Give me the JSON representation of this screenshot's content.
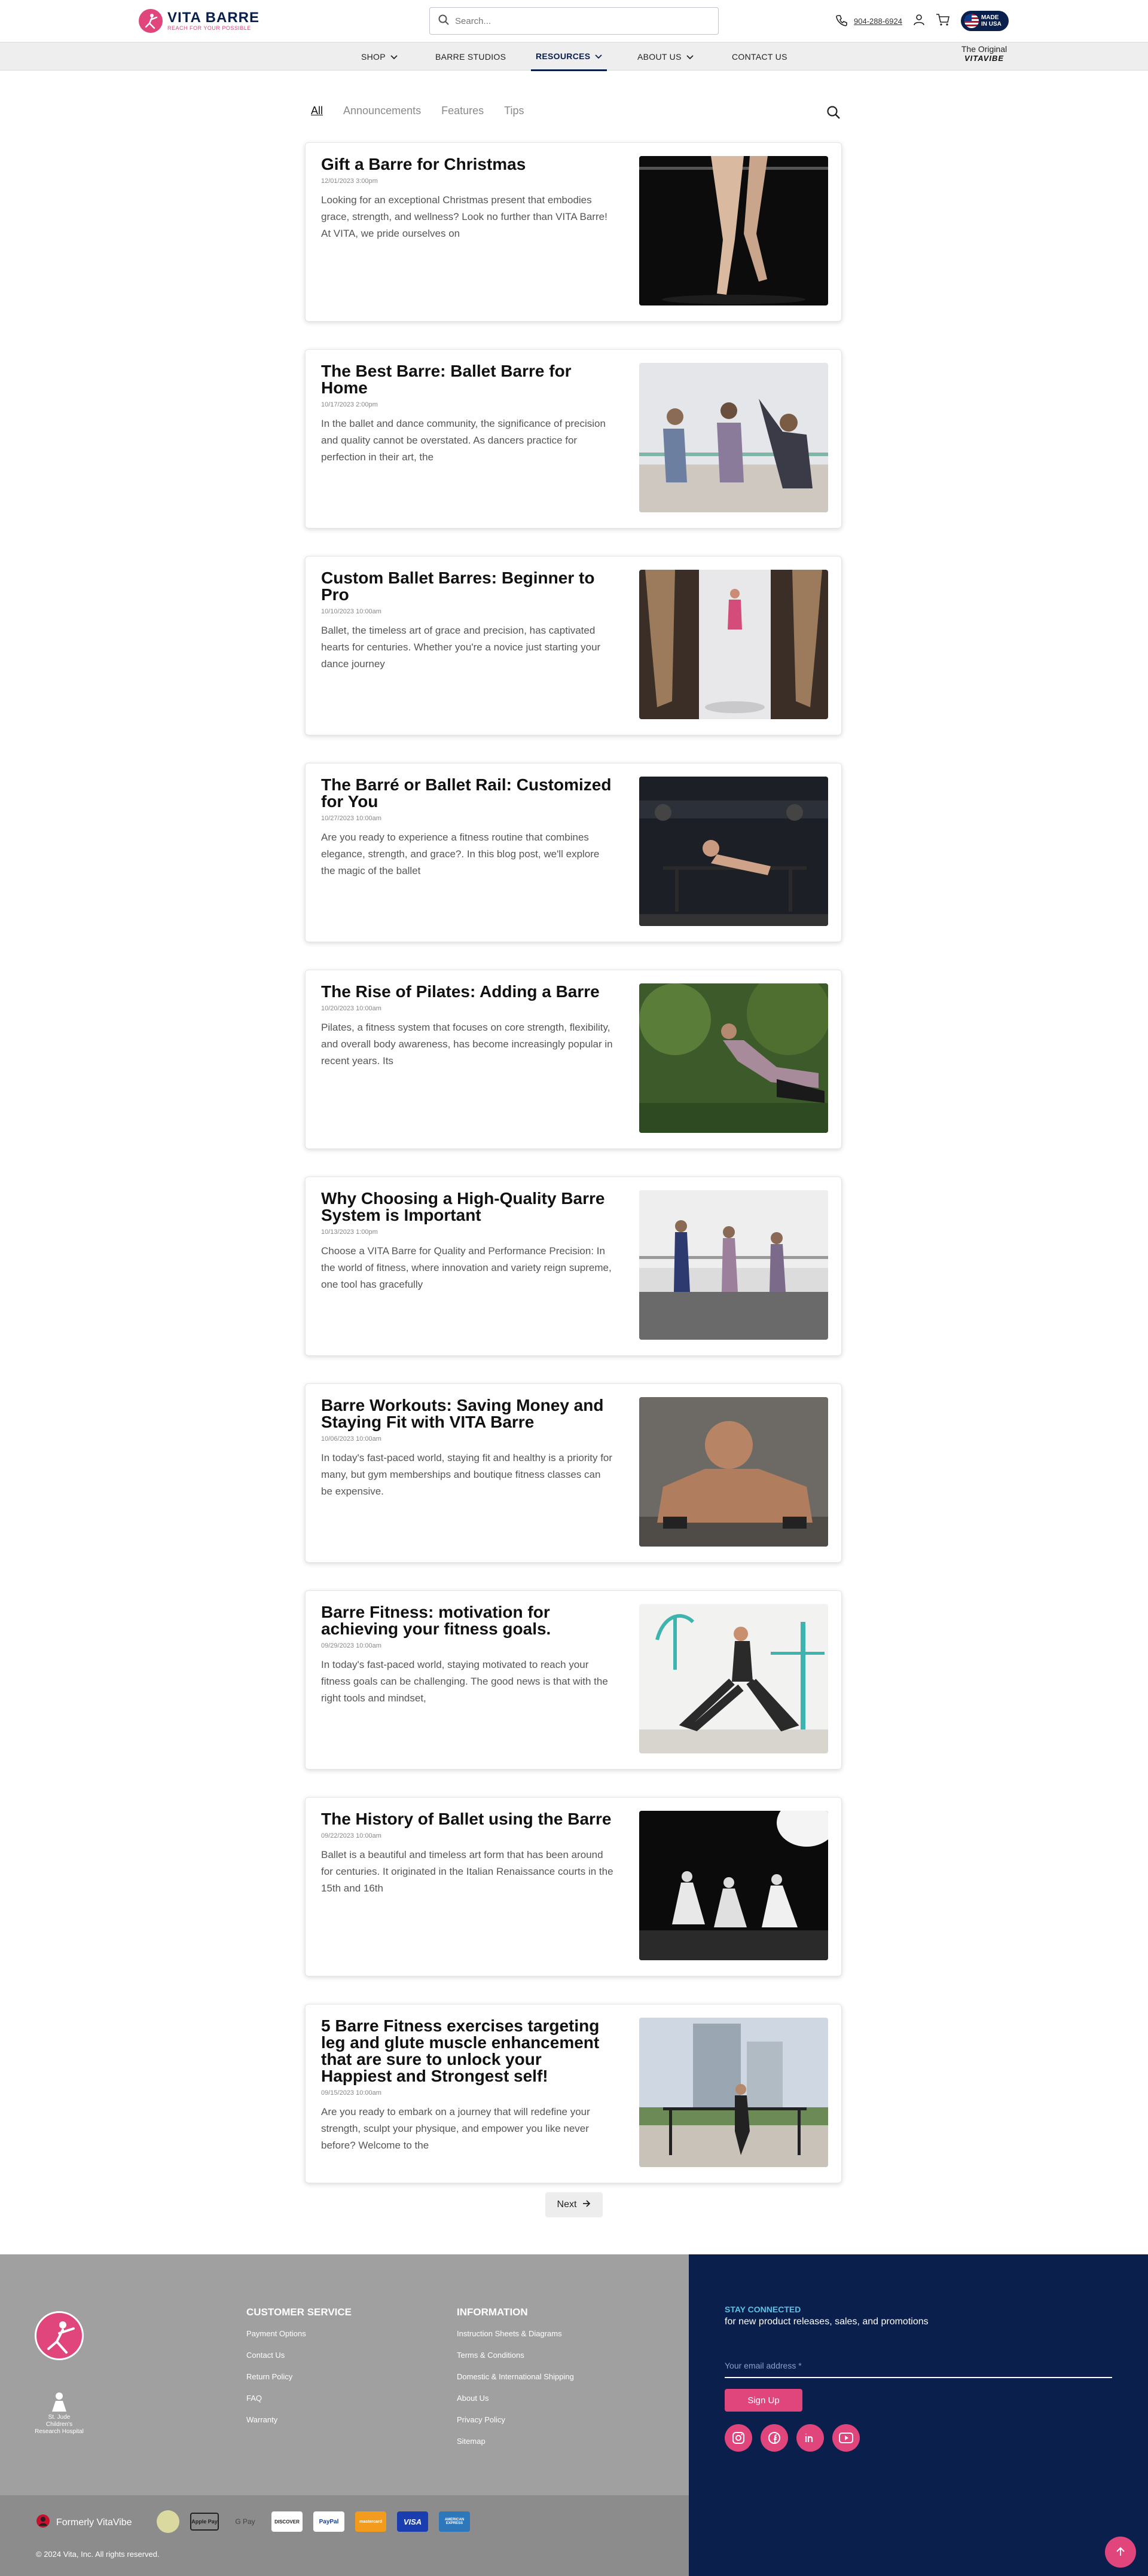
{
  "header": {
    "logo_name": "VITA BARRE",
    "logo_tagline": "REACH FOR YOUR POSSIBLE",
    "search_placeholder": "Search...",
    "phone": "904-288-6924",
    "badge": "MADE IN USA"
  },
  "nav": {
    "items": [
      {
        "label": "SHOP"
      },
      {
        "label": "BARRE STUDIOS"
      },
      {
        "label": "RESOURCES"
      },
      {
        "label": "ABOUT US"
      },
      {
        "label": "CONTACT US"
      }
    ],
    "brand_line1": "The Original",
    "brand_line2": "VITAVIBE"
  },
  "filters": {
    "tabs": [
      "All",
      "Announcements",
      "Features",
      "Tips"
    ],
    "active": "All"
  },
  "posts": [
    {
      "title": "Gift a Barre for Christmas",
      "date": "12/01/2023 3:00pm",
      "excerpt": "Looking for an exceptional Christmas present that embodies grace, strength, and wellness? Look no further than VITA Barre! At VITA, we pride ourselves on"
    },
    {
      "title": "The Best Barre: Ballet Barre for Home",
      "date": "10/17/2023 2:00pm",
      "excerpt": "In the ballet and dance community, the significance of precision and quality cannot be overstated. As dancers practice for perfection in their art, the"
    },
    {
      "title": "Custom Ballet Barres: Beginner to Pro",
      "date": "10/10/2023 10:00am",
      "excerpt": " Ballet, the timeless art of grace and precision, has captivated hearts for centuries. Whether you're a novice just starting your dance journey"
    },
    {
      "title": "The Barré or Ballet Rail: Customized for You",
      "date": "10/27/2023 10:00am",
      "excerpt": "Are you ready to experience a fitness routine that combines elegance, strength, and grace?. In this blog post, we'll explore the magic of the ballet"
    },
    {
      "title": "The Rise of Pilates: Adding a Barre",
      "date": "10/20/2023 10:00am",
      "excerpt": "Pilates, a fitness system that focuses on core strength, flexibility, and overall body awareness, has become increasingly popular in recent years. Its"
    },
    {
      "title": "Why Choosing a High-Quality Barre System is Important",
      "date": "10/13/2023 1:00pm",
      "excerpt": "Choose a VITA Barre for Quality and Performance Precision: In the world of fitness, where innovation and variety reign supreme, one tool has gracefully"
    },
    {
      "title": "Barre Workouts: Saving Money and Staying Fit with VITA Barre",
      "date": "10/06/2023 10:00am",
      "excerpt": "In today's fast-paced world, staying fit and healthy is a priority for many, but gym memberships and boutique fitness classes can be expensive."
    },
    {
      "title": "Barre Fitness: motivation for achieving your fitness goals.",
      "date": "09/29/2023 10:00am",
      "excerpt": "In today's fast-paced world, staying motivated to reach your fitness goals can be challenging. The good news is that with the right tools and mindset,"
    },
    {
      "title": "The History of Ballet using the Barre",
      "date": "09/22/2023 10:00am",
      "excerpt": "Ballet is a beautiful and timeless art form that has been around for centuries. It originated in the Italian Renaissance courts in the 15th and 16th"
    },
    {
      "title": "5 Barre Fitness exercises targeting leg and glute muscle enhancement that are sure to unlock your Happiest and Strongest self!",
      "date": "09/15/2023 10:00am",
      "excerpt": "Are you ready to embark on a journey that will redefine your strength, sculpt your physique, and empower you like never before? Welcome to the"
    }
  ],
  "pagination": {
    "next_label": "Next"
  },
  "footer": {
    "stjude": "St. Jude Children's Research Hospital",
    "customer_service": {
      "title": "CUSTOMER SERVICE",
      "links": [
        "Payment Options",
        "Contact Us",
        "Return Policy",
        "FAQ",
        "Warranty"
      ]
    },
    "information": {
      "title": "INFORMATION",
      "links": [
        "Instruction Sheets & Diagrams",
        "Terms & Conditions",
        "Domestic & International Shipping",
        "About Us",
        "Privacy Policy",
        "Sitemap"
      ]
    },
    "stay_connected": {
      "title": "STAY CONNECTED",
      "subtitle": "for new product releases, sales, and promotions",
      "email_placeholder": "Your email address *",
      "signup_label": "Sign Up"
    },
    "formerly": "Formerly VitaVibe",
    "payments": [
      "Apple Pay",
      "G Pay",
      "DISCOVER",
      "PayPal",
      "mastercard",
      "VISA",
      "AMERICAN EXPRESS"
    ],
    "copyright": "© 2024 Vita, Inc. All rights reserved."
  },
  "colors": {
    "brand_pink": "#e0457b",
    "brand_navy": "#0b1f4d",
    "footer_gray": "#a0a0a0"
  }
}
